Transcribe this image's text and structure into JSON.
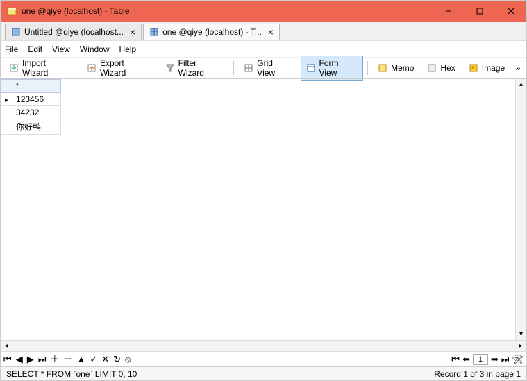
{
  "window": {
    "title": "one @qiye (localhost) - Table"
  },
  "tabs": [
    {
      "label": "Untitled @qiye (localhost...",
      "active": false
    },
    {
      "label": "one @qiye (localhost) - T...",
      "active": true
    }
  ],
  "menu": {
    "file": "File",
    "edit": "Edit",
    "view": "View",
    "window": "Window",
    "help": "Help"
  },
  "toolbar": {
    "import": "Import Wizard",
    "export": "Export Wizard",
    "filter": "Filter Wizard",
    "grid": "Grid View",
    "form": "Form View",
    "memo": "Memo",
    "hex": "Hex",
    "image": "Image"
  },
  "column_header": "f",
  "rows": [
    {
      "val": "123456",
      "current": true
    },
    {
      "val": "34232",
      "current": false
    },
    {
      "val": "你好鸭",
      "current": false
    }
  ],
  "page_input_value": "1",
  "status": {
    "sql": "SELECT * FROM `one` LIMIT 0, 10",
    "record": "Record 1 of 3 in page 1"
  }
}
